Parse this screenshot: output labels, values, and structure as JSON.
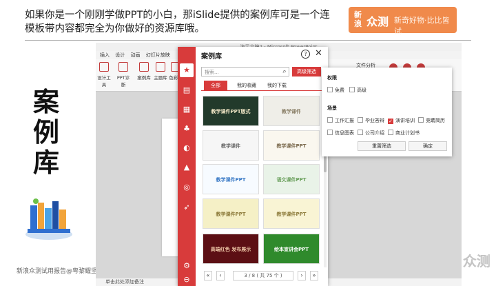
{
  "header": {
    "title": "如果你是一个刚刚学做PPT的小白，那iSlide提供的案例库可是一个连模板带内容都完全为你做好的资源库哦。",
    "brand_logo": "新浪",
    "brand_name": "众测",
    "brand_slogan": "新奇好物·比比皆试"
  },
  "side_label": [
    "案",
    "例",
    "库"
  ],
  "footer": {
    "left": "新浪众测试用报告@粤黎耀坚",
    "right_small": "新浪",
    "right_big": "众测"
  },
  "ppt": {
    "window_title": "演示文稿2 - Microsoft PowerPoint",
    "menu": [
      "插入",
      "设计",
      "动画",
      "幻灯片放映"
    ],
    "ribbon": [
      "设计工具",
      "PPT诊断",
      "案例库",
      "主题库",
      "色彩库"
    ],
    "ribbon_right": "文件分析",
    "notes": "单击此处添加备注"
  },
  "dialog": {
    "title": "案例库",
    "help": "?",
    "close": "✕",
    "search_placeholder": "搜索...",
    "advanced_filter": "高级筛选",
    "tabs": [
      "全部",
      "我的收藏",
      "我的下载"
    ],
    "thumbnails": [
      "教学课件PPT版式",
      "教学课件",
      "教学课件",
      "教学课件PPT",
      "教学课件PPT",
      "语文课件PPT",
      "教学课件PPT",
      "教学课件PPT",
      "高端红色 发布展示",
      "绘本宣讲会PPT"
    ],
    "pager": "3 / 8 ( 共 75 个 )",
    "colors": {
      "accent": "#d83b3b"
    }
  },
  "filter": {
    "perm_title": "权限",
    "perm": [
      {
        "label": "免费",
        "checked": false
      },
      {
        "label": "高级",
        "checked": false
      }
    ],
    "scene_title": "场景",
    "scene": [
      {
        "label": "工作汇报",
        "checked": false
      },
      {
        "label": "毕业答辩",
        "checked": false
      },
      {
        "label": "演讲培训",
        "checked": true
      },
      {
        "label": "竞聘简历",
        "checked": false
      },
      {
        "label": "信息图表",
        "checked": false
      },
      {
        "label": "公司介绍",
        "checked": false
      },
      {
        "label": "商业计划书",
        "checked": false
      }
    ],
    "reset": "重置筛选",
    "confirm": "确定"
  }
}
